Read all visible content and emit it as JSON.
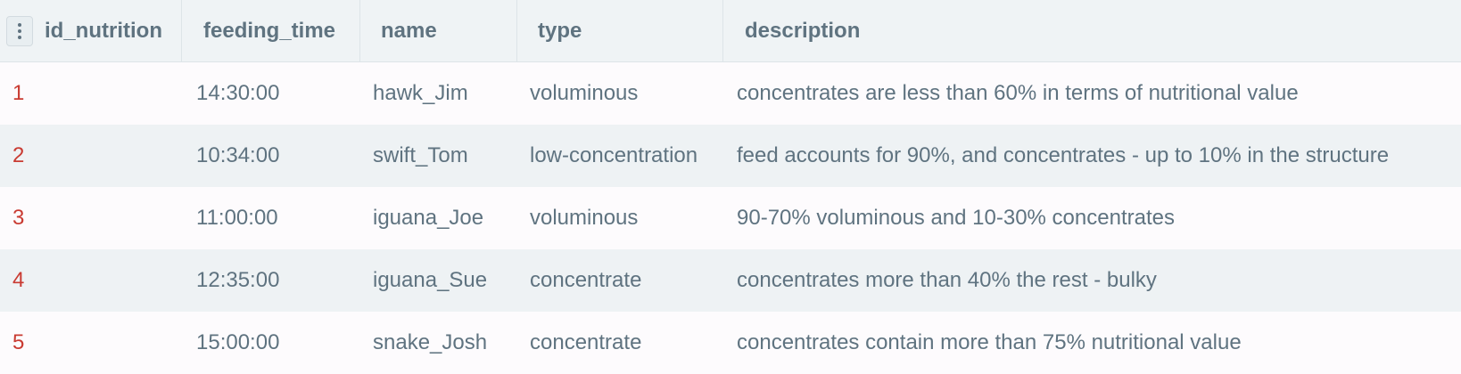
{
  "table": {
    "columns": [
      "id_nutrition",
      "feeding_time",
      "name",
      "type",
      "description"
    ],
    "rows": [
      {
        "id": "1",
        "feeding_time": "14:30:00",
        "name": "hawk_Jim",
        "type": "voluminous",
        "description": "concentrates are less than 60% in terms of nutritional value"
      },
      {
        "id": "2",
        "feeding_time": "10:34:00",
        "name": "swift_Tom",
        "type": "low-concentration",
        "description": "feed accounts for 90%, and concentrates - up to 10% in the structure"
      },
      {
        "id": "3",
        "feeding_time": "11:00:00",
        "name": "iguana_Joe",
        "type": "voluminous",
        "description": "90-70% voluminous and 10-30% concentrates"
      },
      {
        "id": "4",
        "feeding_time": "12:35:00",
        "name": "iguana_Sue",
        "type": "concentrate",
        "description": "concentrates more than 40% the rest - bulky"
      },
      {
        "id": "5",
        "feeding_time": "15:00:00",
        "name": "snake_Josh",
        "type": "concentrate",
        "description": "concentrates contain more than 75% nutritional value"
      }
    ]
  },
  "colors": {
    "header_bg": "#eff3f5",
    "text": "#5f7380",
    "id_text": "#c93b32",
    "row_alt_bg": "#eef2f4"
  },
  "icons": {
    "column_menu": "vertical-dots-icon"
  }
}
